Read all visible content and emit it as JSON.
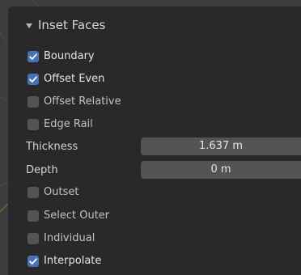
{
  "panel": {
    "title": "Inset Faces",
    "chevron_icon": "chevron-down-icon",
    "accent_color": "#4772b3"
  },
  "options": [
    {
      "label": "Boundary",
      "checked": true
    },
    {
      "label": "Offset Even",
      "checked": true
    },
    {
      "label": "Offset Relative",
      "checked": false
    },
    {
      "label": "Edge Rail",
      "checked": false
    }
  ],
  "fields": {
    "thickness": {
      "label": "Thickness",
      "value": "1.637 m"
    },
    "depth": {
      "label": "Depth",
      "value": "0 m"
    }
  },
  "options2": [
    {
      "label": "Outset",
      "checked": false
    },
    {
      "label": "Select Outer",
      "checked": false
    },
    {
      "label": "Individual",
      "checked": false
    },
    {
      "label": "Interpolate",
      "checked": true
    }
  ]
}
